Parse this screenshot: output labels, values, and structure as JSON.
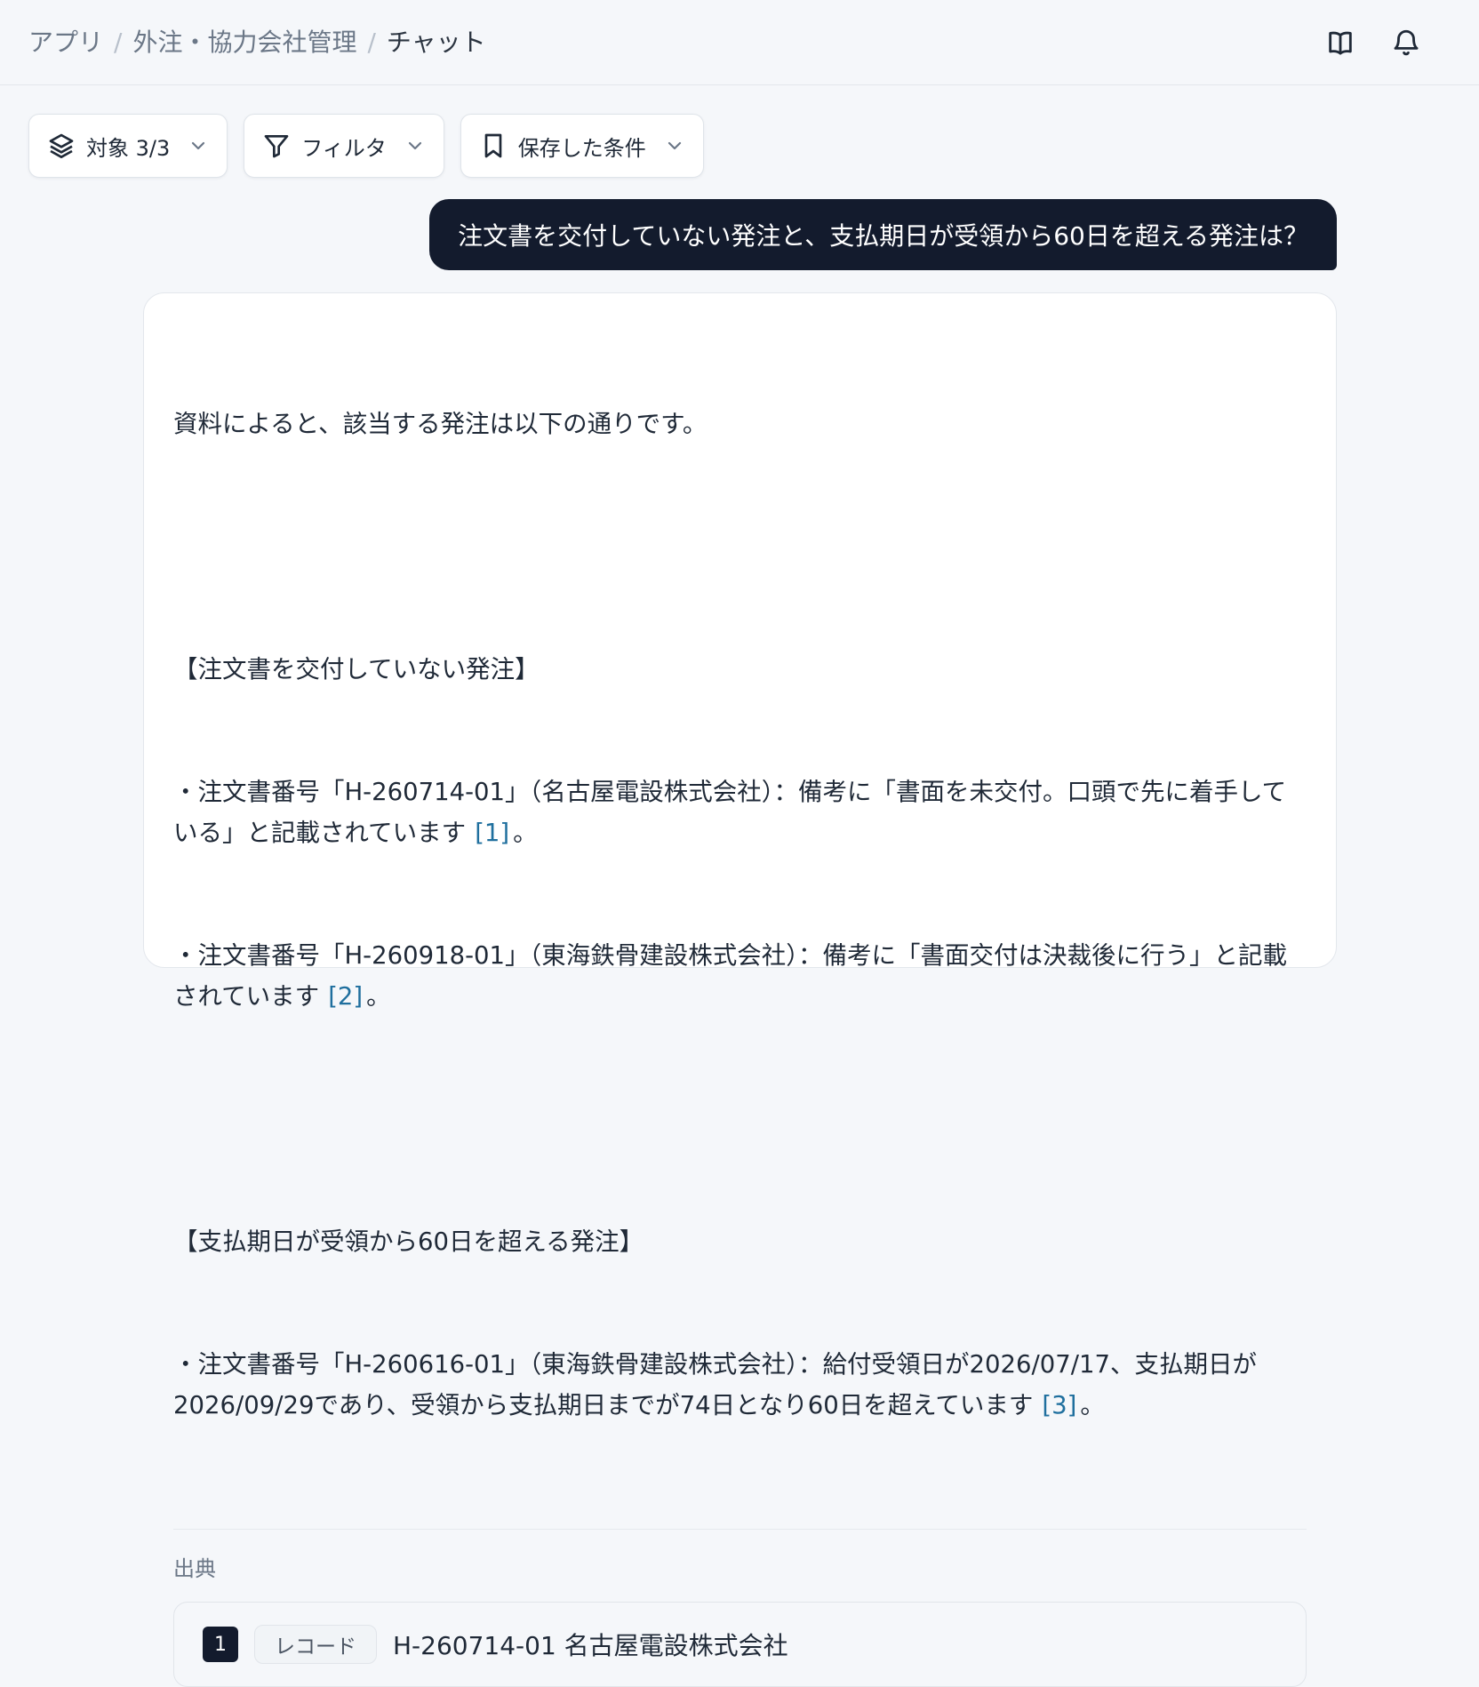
{
  "breadcrumb": {
    "items": [
      "アプリ",
      "外注・協力会社管理",
      "チャット"
    ],
    "separator": "/"
  },
  "header_icons": [
    "book-open-icon",
    "bell-icon"
  ],
  "toolbar": {
    "target_label": "対象 3/3",
    "filter_label": "フィルタ",
    "saved_label": "保存した条件"
  },
  "user_message": "注文書を交付していない発注と、支払期日が受領から60日を超える発注は？",
  "answer": {
    "intro": "資料によると、該当する発注は以下の通りです。",
    "section1_heading": "【注文書を交付していない発注】",
    "item1_text": "・注文書番号「H-260714-01」（名古屋電設株式会社）：備考に「書面を未交付。口頭で先に着手している」と記載されています",
    "item1_cite": "[1]",
    "item2_text": "・注文書番号「H-260918-01」（東海鉄骨建設株式会社）：備考に「書面交付は決裁後に行う」と記載されています",
    "item2_cite": "[2]",
    "section2_heading": "【支払期日が受領から60日を超える発注】",
    "item3_text": "・注文書番号「H-260616-01」（東海鉄骨建設株式会社）：給付受領日が2026/07/17、支払期日が2026/09/29であり、受領から支払期日までが74日となり60日を超えています",
    "item3_cite": "[3]",
    "period": "。"
  },
  "sources": {
    "label": "出典",
    "items": [
      {
        "number": "1",
        "tag": "レコード",
        "title": "H-260714-01 名古屋電設株式会社"
      }
    ]
  },
  "colors": {
    "background": "#f5f7fa",
    "user_bubble": "#131b2d",
    "citation": "#1f6f9e"
  }
}
